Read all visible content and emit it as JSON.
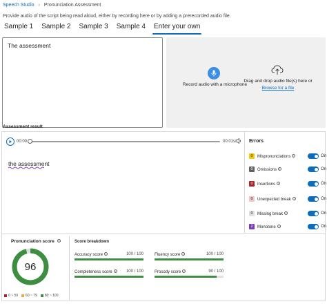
{
  "breadcrumb": {
    "root": "Speech Studio",
    "current": "Pronunciation Assessment"
  },
  "intro_text": "Provide audio of the script being read aloud, either by recording here or by adding a prerecorded audio file.",
  "tabs": [
    {
      "label": "Sample 1",
      "active": false
    },
    {
      "label": "Sample 2",
      "active": false
    },
    {
      "label": "Sample 3",
      "active": false
    },
    {
      "label": "Sample 4",
      "active": false
    },
    {
      "label": "Enter your own",
      "active": true
    }
  ],
  "script_text": "The assessment",
  "upload": {
    "record_label": "Record audio with a microphone",
    "drop_label": "Drag and drop audio file(s) here or",
    "browse_label": "Browse for a file"
  },
  "result_title": "Assessment result",
  "player": {
    "time_start": "00:00",
    "time_end": "00:01s",
    "progress": 0
  },
  "transcript": "the assessment",
  "errors": {
    "title": "Errors",
    "items": [
      {
        "badge": "0",
        "label": "Mispronunciations",
        "toggle": "On",
        "badge_bg": "#f2c811",
        "badge_fg": "#242424"
      },
      {
        "badge": "0",
        "label": "Omissions",
        "toggle": "On",
        "badge_bg": "#616161",
        "badge_fg": "#ffffff"
      },
      {
        "badge": "0",
        "label": "Insertions",
        "toggle": "On",
        "badge_bg": "#a4262c",
        "badge_fg": "#ffffff"
      },
      {
        "badge": "0",
        "label": "Unexpected break",
        "toggle": "On",
        "badge_bg": "#f4c6c9",
        "badge_fg": "#242424"
      },
      {
        "badge": "0",
        "label": "Missing break",
        "toggle": "On",
        "badge_bg": "#e0e0e0",
        "badge_fg": "#242424"
      },
      {
        "badge": "2",
        "label": "Monotone",
        "toggle": "On",
        "badge_bg": "#7b3fb5",
        "badge_fg": "#ffffff"
      }
    ]
  },
  "pronunciation": {
    "title": "Pronunciation score",
    "score": "96",
    "score_fraction": 0.96,
    "legend": [
      {
        "label": "0 ~ 59",
        "color": "#a4262c"
      },
      {
        "label": "60 ~ 79",
        "color": "#f2a93b"
      },
      {
        "label": "80 ~ 100",
        "color": "#3e8e41"
      }
    ]
  },
  "breakdown": {
    "title": "Score breakdown",
    "metrics": [
      {
        "label": "Accuracy score",
        "value": "100 / 100",
        "fraction": 1.0
      },
      {
        "label": "Fluency score",
        "value": "100 / 100",
        "fraction": 1.0
      },
      {
        "label": "Completeness score",
        "value": "100 / 100",
        "fraction": 1.0
      },
      {
        "label": "Prosody score",
        "value": "90 / 100",
        "fraction": 0.9
      }
    ]
  },
  "colors": {
    "accent": "#0f6cbd",
    "good": "#3e8e41"
  },
  "icons": {
    "mic": "microphone-icon",
    "upload": "cloud-upload-icon",
    "play": "play-icon",
    "volume": "volume-icon",
    "info": "info-icon"
  }
}
